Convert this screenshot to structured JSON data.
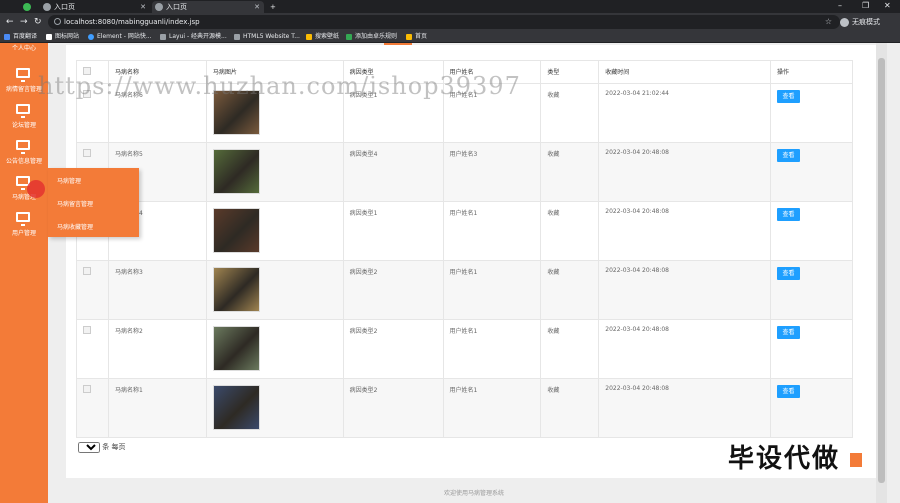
{
  "browser": {
    "tabs": [
      {
        "label": "入口页"
      },
      {
        "label": "入口页"
      }
    ],
    "url": "localhost:8080/mabingguanli/index.jsp",
    "profile_label": "无痕模式",
    "bookmarks": [
      "百度翻译",
      "图标网站",
      "Element - 网站快...",
      "Layui - 经典开源模...",
      "HTML5 Website T...",
      "搜索壁纸",
      "添加由卓乐规则",
      "首页"
    ]
  },
  "sidebar": {
    "top_label": "个人中心",
    "items": [
      {
        "label": "病情留言管理",
        "icon": "monitor-icon"
      },
      {
        "label": "论坛管理",
        "icon": "monitor-icon"
      },
      {
        "label": "公告信息管理",
        "icon": "monitor-icon"
      },
      {
        "label": "马病管理",
        "icon": "monitor-icon"
      },
      {
        "label": "用户管理",
        "icon": "monitor-icon"
      }
    ],
    "flyout": [
      "马病管理",
      "马病留言管理",
      "马病收藏管理"
    ]
  },
  "table": {
    "headers": [
      "马病名称",
      "马病图片",
      "病因类型",
      "用户姓名",
      "类型",
      "收藏时间",
      "操作"
    ],
    "rows": [
      {
        "name": "马病名称6",
        "cause": "病因类型1",
        "user": "用户姓名1",
        "type": "收藏",
        "time": "2022-03-04 21:02:44",
        "action": "查看",
        "photo": "#7a5a3c"
      },
      {
        "name": "马病名称5",
        "cause": "病因类型4",
        "user": "用户姓名3",
        "type": "收藏",
        "time": "2022-03-04 20:48:08",
        "action": "查看",
        "photo": "#556b3a"
      },
      {
        "name": "马病名称4",
        "cause": "病因类型1",
        "user": "用户姓名1",
        "type": "收藏",
        "time": "2022-03-04 20:48:08",
        "action": "查看",
        "photo": "#5a3a2a"
      },
      {
        "name": "马病名称3",
        "cause": "病因类型2",
        "user": "用户姓名1",
        "type": "收藏",
        "time": "2022-03-04 20:48:08",
        "action": "查看",
        "photo": "#a08450"
      },
      {
        "name": "马病名称2",
        "cause": "病因类型2",
        "user": "用户姓名1",
        "type": "收藏",
        "time": "2022-03-04 20:48:08",
        "action": "查看",
        "photo": "#6b7a5e"
      },
      {
        "name": "马病名称1",
        "cause": "病因类型2",
        "user": "用户姓名1",
        "type": "收藏",
        "time": "2022-03-04 20:48:08",
        "action": "查看",
        "photo": "#3b4a6b"
      }
    ]
  },
  "pager": {
    "page_size": "10",
    "suffix": "条 每页"
  },
  "footer": "欢迎使用马病管理系统",
  "watermark": "https://www.huzhan.com/ishop39397",
  "stamp": "毕设代做",
  "colors": {
    "accent": "#f37b38",
    "button": "#1e9fff"
  }
}
